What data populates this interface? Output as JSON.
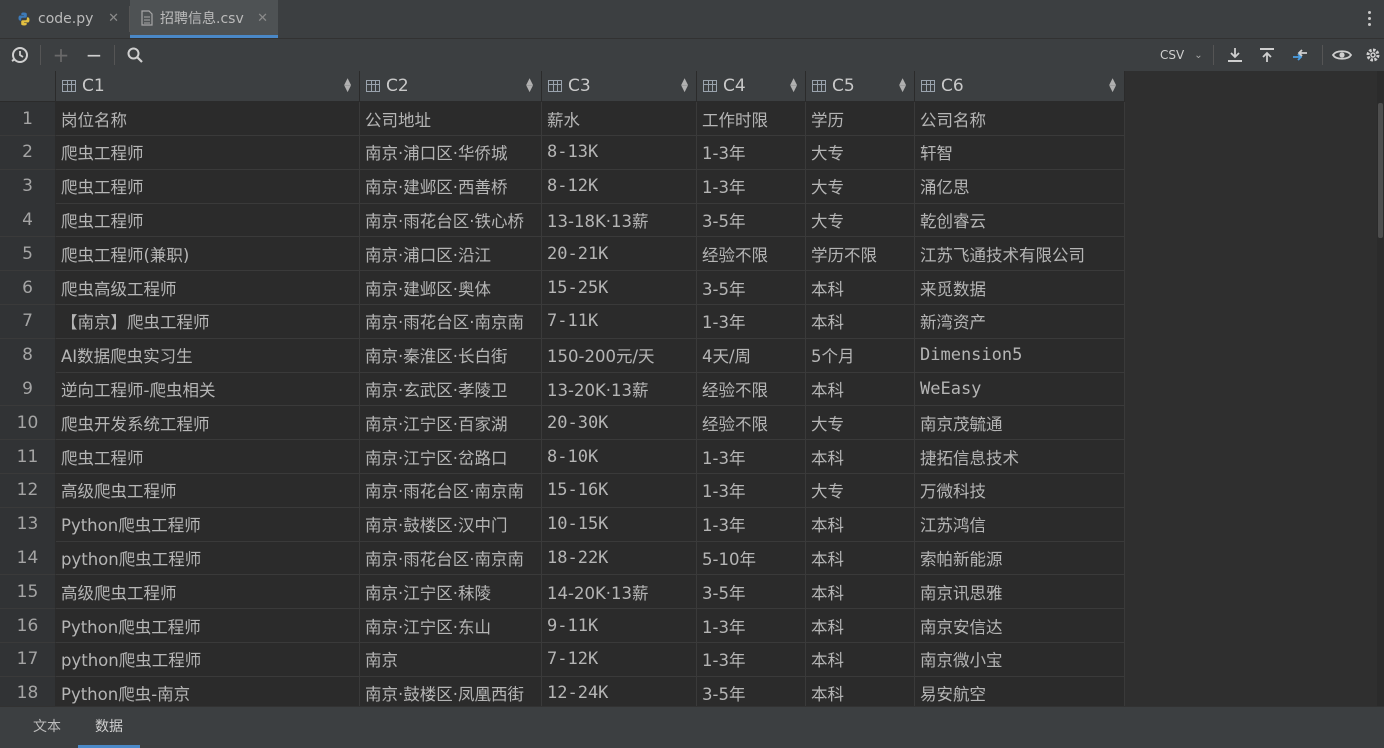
{
  "tabs": [
    {
      "label": "code.py",
      "icon": "python-file-icon"
    },
    {
      "label": "招聘信息.csv",
      "icon": "csv-file-icon",
      "active": true
    }
  ],
  "toolbar": {
    "format": "CSV",
    "icons": [
      "history-icon",
      "add-row-icon",
      "remove-row-icon",
      "search-icon",
      "export-icon",
      "import-icon",
      "compare-icon",
      "view-icon",
      "settings-icon"
    ]
  },
  "columns": [
    "C1",
    "C2",
    "C3",
    "C4",
    "C5",
    "C6"
  ],
  "rows": [
    {
      "n": "1",
      "c": [
        "岗位名称",
        "公司地址",
        "薪水",
        "工作时限",
        "学历",
        "公司名称"
      ]
    },
    {
      "n": "2",
      "c": [
        "爬虫工程师",
        "南京·浦口区·华侨城",
        "8-13K",
        "1-3年",
        "大专",
        "轩智"
      ]
    },
    {
      "n": "3",
      "c": [
        "爬虫工程师",
        "南京·建邺区·西善桥",
        "8-12K",
        "1-3年",
        "大专",
        "涌亿思"
      ]
    },
    {
      "n": "4",
      "c": [
        "爬虫工程师",
        "南京·雨花台区·铁心桥",
        "13-18K·13薪",
        "3-5年",
        "大专",
        "乾创睿云"
      ]
    },
    {
      "n": "5",
      "c": [
        "爬虫工程师(兼职)",
        "南京·浦口区·沿江",
        "20-21K",
        "经验不限",
        "学历不限",
        "江苏飞通技术有限公司"
      ]
    },
    {
      "n": "6",
      "c": [
        "爬虫高级工程师",
        "南京·建邺区·奥体",
        "15-25K",
        "3-5年",
        "本科",
        "来觅数据"
      ]
    },
    {
      "n": "7",
      "c": [
        "【南京】爬虫工程师",
        "南京·雨花台区·南京南",
        "7-11K",
        "1-3年",
        "本科",
        "新湾资产"
      ]
    },
    {
      "n": "8",
      "c": [
        "AI数据爬虫实习生",
        "南京·秦淮区·长白街",
        "150-200元/天",
        "4天/周",
        "5个月",
        "Dimension5"
      ]
    },
    {
      "n": "9",
      "c": [
        "逆向工程师-爬虫相关",
        "南京·玄武区·孝陵卫",
        "13-20K·13薪",
        "经验不限",
        "本科",
        "WeEasy"
      ]
    },
    {
      "n": "10",
      "c": [
        "爬虫开发系统工程师",
        "南京·江宁区·百家湖",
        "20-30K",
        "经验不限",
        "大专",
        "南京茂毓通"
      ]
    },
    {
      "n": "11",
      "c": [
        "爬虫工程师",
        "南京·江宁区·岔路口",
        "8-10K",
        "1-3年",
        "本科",
        "捷拓信息技术"
      ]
    },
    {
      "n": "12",
      "c": [
        "高级爬虫工程师",
        "南京·雨花台区·南京南",
        "15-16K",
        "1-3年",
        "大专",
        "万微科技"
      ]
    },
    {
      "n": "13",
      "c": [
        "Python爬虫工程师",
        "南京·鼓楼区·汉中门",
        "10-15K",
        "1-3年",
        "本科",
        "江苏鸿信"
      ]
    },
    {
      "n": "14",
      "c": [
        "python爬虫工程师",
        "南京·雨花台区·南京南",
        "18-22K",
        "5-10年",
        "本科",
        "索帕新能源"
      ]
    },
    {
      "n": "15",
      "c": [
        "高级爬虫工程师",
        "南京·江宁区·秣陵",
        "14-20K·13薪",
        "3-5年",
        "本科",
        "南京讯思雅"
      ]
    },
    {
      "n": "16",
      "c": [
        "Python爬虫工程师",
        "南京·江宁区·东山",
        "9-11K",
        "1-3年",
        "本科",
        "南京安信达"
      ]
    },
    {
      "n": "17",
      "c": [
        "python爬虫工程师",
        "南京",
        "7-12K",
        "1-3年",
        "本科",
        "南京微小宝"
      ]
    },
    {
      "n": "18",
      "c": [
        "Python爬虫-南京",
        "南京·鼓楼区·凤凰西街",
        "12-24K",
        "3-5年",
        "本科",
        "易安航空"
      ]
    }
  ],
  "bottom_tabs": [
    {
      "label": "文本"
    },
    {
      "label": "数据",
      "active": true
    }
  ]
}
